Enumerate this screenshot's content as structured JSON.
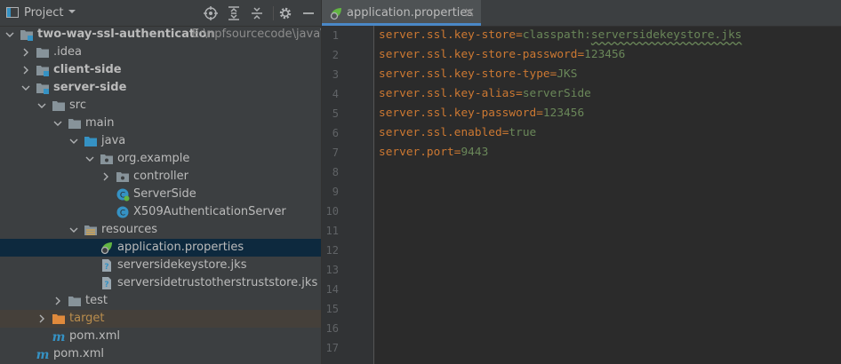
{
  "project_panel": {
    "title": "Project",
    "tree": [
      {
        "label": "two-way-ssl-authentication",
        "path": "E:\\npfsourcecode\\java\\sc",
        "icon": "module-folder-icon",
        "expanded": true
      },
      {
        "label": ".idea",
        "icon": "folder-icon",
        "expanded": false
      },
      {
        "label": "client-side",
        "icon": "module-folder-icon",
        "expanded": false
      },
      {
        "label": "server-side",
        "icon": "module-folder-icon",
        "expanded": true
      },
      {
        "label": "src",
        "icon": "folder-icon",
        "expanded": true
      },
      {
        "label": "main",
        "icon": "folder-icon",
        "expanded": true
      },
      {
        "label": "java",
        "icon": "source-root-folder-icon",
        "expanded": true
      },
      {
        "label": "org.example",
        "icon": "package-icon",
        "expanded": true
      },
      {
        "label": "controller",
        "icon": "package-icon",
        "expanded": false
      },
      {
        "label": "ServerSide",
        "icon": "spring-boot-class-icon"
      },
      {
        "label": "X509AuthenticationServer",
        "icon": "class-icon"
      },
      {
        "label": "resources",
        "icon": "resources-folder-icon",
        "expanded": true
      },
      {
        "label": "application.properties",
        "icon": "spring-properties-icon",
        "selected": true
      },
      {
        "label": "serversidekeystore.jks",
        "icon": "unknown-file-icon"
      },
      {
        "label": "serversidetrustotherstruststore.jks",
        "icon": "unknown-file-icon"
      },
      {
        "label": "test",
        "icon": "folder-icon",
        "expanded": false
      },
      {
        "label": "target",
        "icon": "excluded-folder-icon",
        "expanded": false
      },
      {
        "label": "pom.xml",
        "icon": "maven-icon"
      },
      {
        "label": "pom.xml",
        "icon": "maven-icon"
      }
    ]
  },
  "editor": {
    "tab_label": "application.properties",
    "line_numbers": [
      "1",
      "2",
      "3",
      "4",
      "5",
      "6",
      "7",
      "8",
      "9",
      "10",
      "11",
      "12",
      "13",
      "14",
      "15",
      "16",
      "17"
    ],
    "lines": [
      {
        "key": "server.ssl.key-store",
        "value": "classpath:",
        "value2": "serversidekeystore.jks"
      },
      {
        "key": "server.ssl.key-store-password",
        "value": "123456"
      },
      {
        "key": "server.ssl.key-store-type",
        "value": "JKS"
      },
      {
        "key": "server.ssl.key-alias",
        "value": "serverSide"
      },
      {
        "key": "server.ssl.key-password",
        "value": "123456"
      },
      {
        "key": "server.ssl.enabled",
        "value": "true"
      },
      {
        "key": "server.port",
        "value": "9443"
      }
    ],
    "equals": "="
  },
  "colors": {
    "key": "#cc7832",
    "value": "#6a8759",
    "selection": "#0d293e",
    "panel_bg": "#3c3f41",
    "editor_bg": "#2b2b2b",
    "excluded_folder": "#ba8d4d"
  }
}
